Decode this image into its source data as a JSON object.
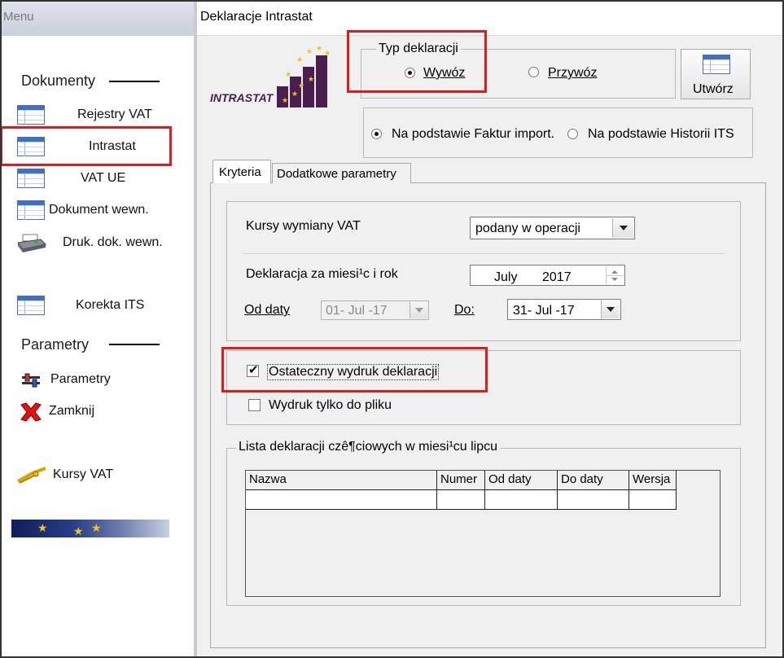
{
  "menu": {
    "title": "Menu",
    "sections": {
      "dokumenty": "Dokumenty",
      "parametry": "Parametry"
    },
    "items": {
      "rejestry_vat": "Rejestry VAT",
      "intrastat": "Intrastat",
      "vat_ue": "VAT UE",
      "dokument_wewn": "Dokument wewn.",
      "druk_dok_wewn": "Druk. dok. wewn.",
      "korekta_its": "Korekta ITS",
      "parametry": "Parametry",
      "zamknij": "Zamknij",
      "kursy_vat": "Kursy VAT"
    }
  },
  "panel": {
    "title": "Deklaracje Intrastat",
    "logo_text": "INTRASTAT",
    "typ_deklaracji": {
      "legend": "Typ deklaracji",
      "wywoz": "Wywóz",
      "przywoz": "Przywóz",
      "selected": "wywoz"
    },
    "utworz_label": "Utwórz",
    "source": {
      "faktur": "Na podstawie Faktur import.",
      "historii": "Na podstawie Historii ITS",
      "selected": "faktur"
    },
    "tabs": {
      "kryteria": "Kryteria",
      "dodatkowe": "Dodatkowe parametry"
    },
    "kryteria": {
      "kursy_label": "Kursy wymiany VAT",
      "kursy_value": "podany w operacji",
      "deklaracja_label": "Deklaracja za miesi¹c i rok",
      "month": "July",
      "year": "2017",
      "od_daty_label": "Od daty",
      "od_daty_value": "01- Jul -17",
      "do_label": "Do:",
      "do_value": "31- Jul -17",
      "ostateczny_label": "Ostateczny wydruk deklaracji",
      "ostateczny_checked": true,
      "wydruk_label": "Wydruk tylko do pliku",
      "wydruk_checked": false,
      "lista_legend": "Lista deklaracji czê¶ciowych w miesi¹cu lipcu",
      "columns": [
        "Nazwa",
        "Numer",
        "Od daty",
        "Do daty",
        "Wersja"
      ]
    }
  },
  "colors": {
    "highlight": "#e11b1b",
    "eu_blue": "#0e1e5c",
    "eu_star": "#f1c21b",
    "logo_purple": "#4a1f4f"
  }
}
